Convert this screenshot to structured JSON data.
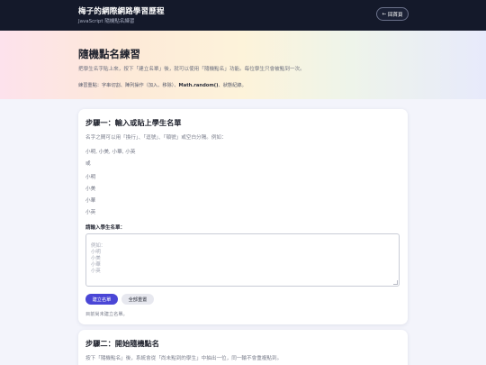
{
  "header": {
    "title": "梅子的網際網路學習歷程",
    "subtitle": "JavaScript 隨機點名練習",
    "back_icon": "←",
    "back_label": "回首頁"
  },
  "hero": {
    "title": "隨機點名練習",
    "description": "把學生名字貼上來，按下「建立名單」後，就可以使用「隨機點名」功能。每位學生只會被點到一次。",
    "concepts_prefix": "練習重點：字串切割、陣列操作（加入、移除）、",
    "concepts_bold": "Math.random()",
    "concepts_suffix": "、狀態紀錄。"
  },
  "step1": {
    "title": "步驟一：輸入或貼上學生名單",
    "description": "名字之間可以用「換行」、「逗號」、「頓號」或空白分隔。例如：",
    "example_inline": "小明, 小美, 小華, 小英",
    "or_label": "或",
    "example_lines": [
      "小明",
      "小美",
      "小華",
      "小英"
    ],
    "textarea_label": "請輸入學生名單：",
    "textarea_placeholder": "例如：\n小明\n小美\n小華\n小英",
    "build_button": "建立名單",
    "reset_button": "全部重置",
    "status": "目前尚未建立名單。"
  },
  "step2": {
    "title": "步驟二：開始隨機點名",
    "description": "按下「隨機點名」後，系統會從「尚未點到的學生」中抽出一位，同一輪不會重複點到。"
  },
  "colors": {
    "topbar": "#14192a",
    "primary_button": "#4a46d6",
    "page_background": "#f3f4fb"
  }
}
